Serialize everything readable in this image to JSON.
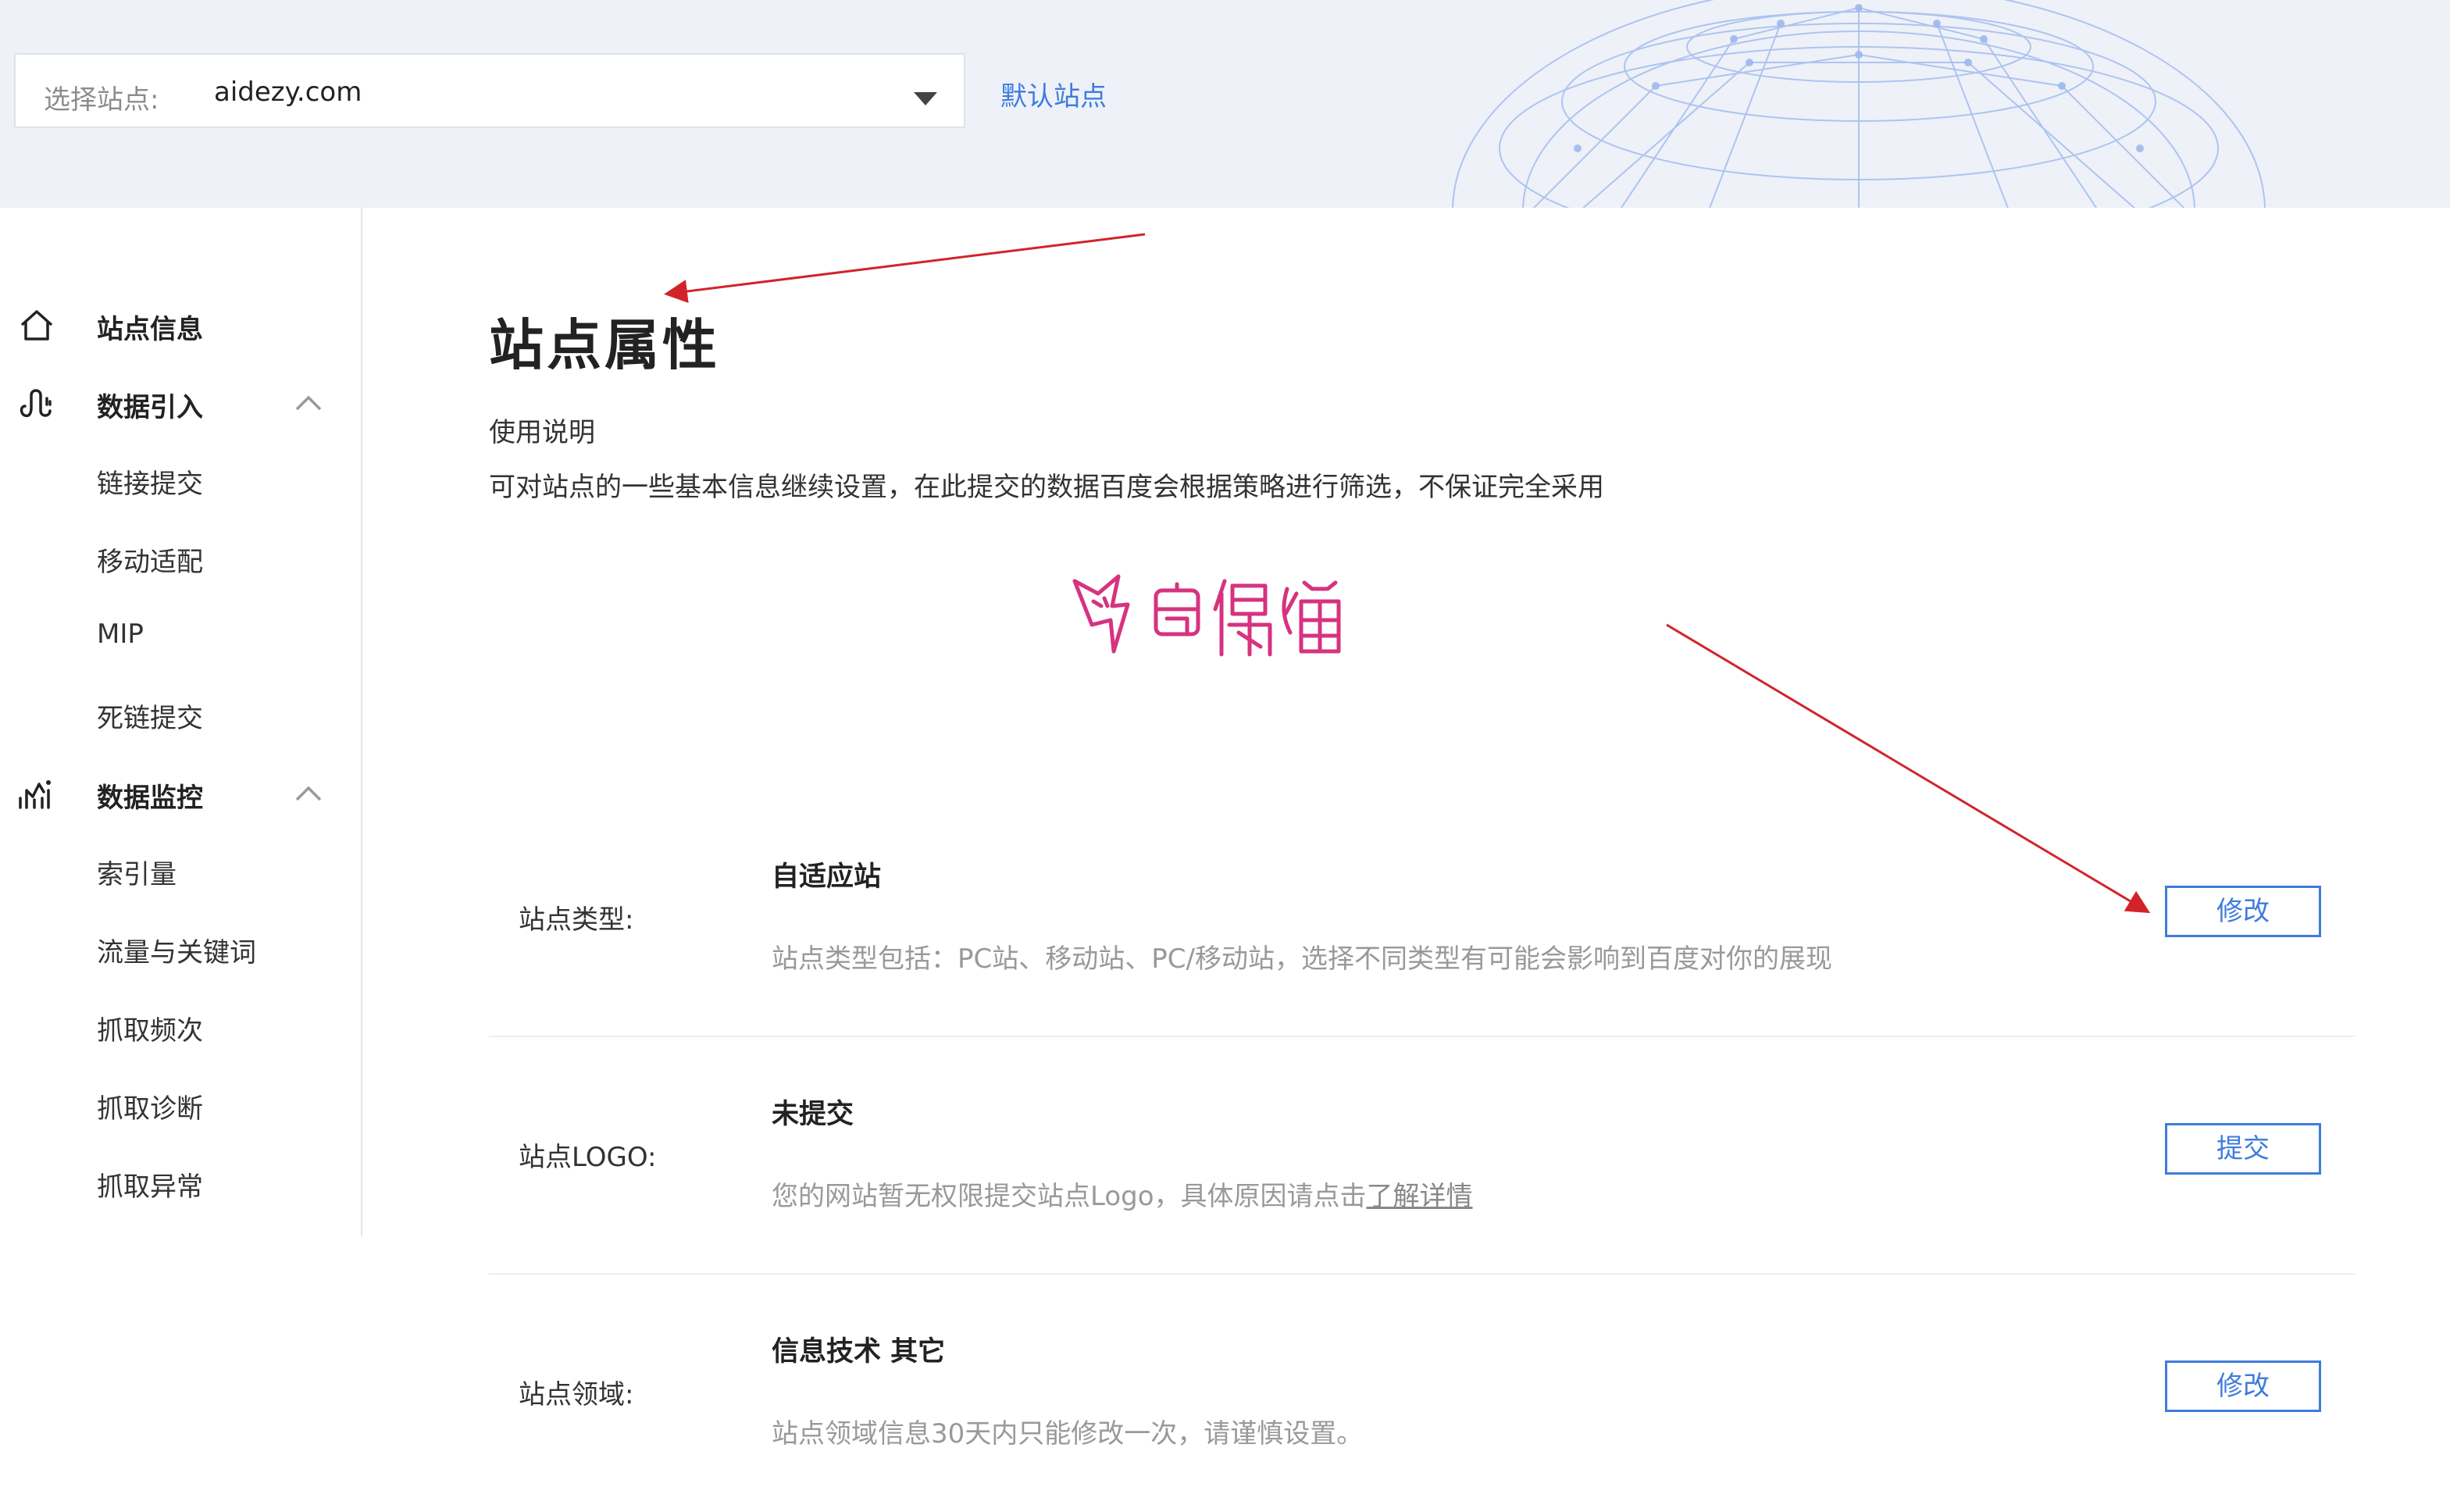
{
  "header": {
    "site_select_label": "选择站点:",
    "site_select_value": "aidezy.com",
    "default_site_link": "默认站点"
  },
  "sidebar": {
    "site_info": "站点信息",
    "data_import": {
      "label": "数据引入",
      "items": [
        "链接提交",
        "移动适配",
        "MIP",
        "死链提交"
      ]
    },
    "data_monitor": {
      "label": "数据监控",
      "items": [
        "索引量",
        "流量与关键词",
        "抓取频次",
        "抓取诊断",
        "抓取异常"
      ]
    }
  },
  "main": {
    "title": "站点属性",
    "usage_title": "使用说明",
    "usage_desc": "可对站点的一些基本信息继续设置，在此提交的数据百度会根据策略进行筛选，不保证完全采用",
    "properties": [
      {
        "label": "站点类型:",
        "value": "自适应站",
        "desc": "站点类型包括：PC站、移动站、PC/移动站，选择不同类型有可能会影响到百度对你的展现",
        "button": "修改"
      },
      {
        "label": "站点LOGO:",
        "value": "未提交",
        "desc": "您的网站暂无权限提交站点Logo，具体原因请点击",
        "desc_link": "了解详情",
        "button": "提交"
      },
      {
        "label": "站点领域:",
        "value": "信息技术 其它",
        "desc": "站点领域信息30天内只能修改一次，请谨慎设置。",
        "button": "修改"
      }
    ]
  },
  "watermark": "奇偶猫",
  "colors": {
    "accent": "#3e7cdd",
    "annotation_arrow": "#d2232a",
    "watermark": "#d6337f",
    "banner_bg": "#eef1f8"
  }
}
